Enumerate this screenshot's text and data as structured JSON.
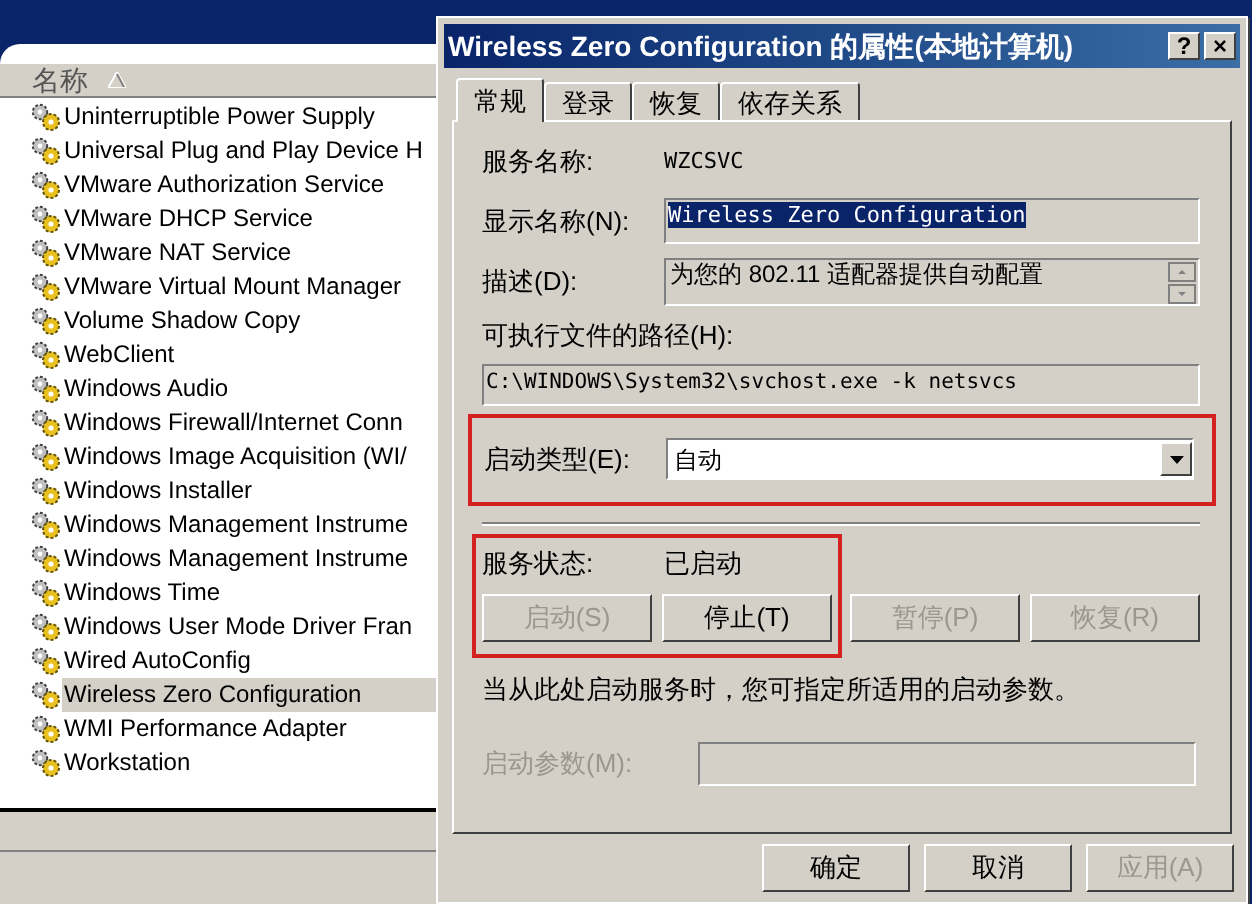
{
  "services_list": {
    "header": "名称",
    "header_sorted": true,
    "rows": [
      {
        "name": "Uninterruptible Power Supply",
        "selected": false
      },
      {
        "name": "Universal Plug and Play Device H",
        "selected": false
      },
      {
        "name": "VMware Authorization Service",
        "selected": false
      },
      {
        "name": "VMware DHCP Service",
        "selected": false
      },
      {
        "name": "VMware NAT Service",
        "selected": false
      },
      {
        "name": "VMware Virtual Mount Manager",
        "selected": false
      },
      {
        "name": "Volume Shadow Copy",
        "selected": false
      },
      {
        "name": "WebClient",
        "selected": false
      },
      {
        "name": "Windows Audio",
        "selected": false
      },
      {
        "name": "Windows Firewall/Internet Conn",
        "selected": false
      },
      {
        "name": "Windows Image Acquisition (WI/",
        "selected": false
      },
      {
        "name": "Windows Installer",
        "selected": false
      },
      {
        "name": "Windows Management Instrume",
        "selected": false
      },
      {
        "name": "Windows Management Instrume",
        "selected": false
      },
      {
        "name": "Windows Time",
        "selected": false
      },
      {
        "name": "Windows User Mode Driver Fran",
        "selected": false
      },
      {
        "name": "Wired AutoConfig",
        "selected": false
      },
      {
        "name": "Wireless Zero Configuration",
        "selected": true
      },
      {
        "name": "WMI Performance Adapter",
        "selected": false
      },
      {
        "name": "Workstation",
        "selected": false
      }
    ]
  },
  "dialog": {
    "title": "Wireless Zero Configuration 的属性(本地计算机)",
    "title_buttons": [
      "?",
      "×"
    ],
    "tabs": [
      {
        "label": "常规",
        "selected": true
      },
      {
        "label": "登录",
        "selected": false
      },
      {
        "label": "恢复",
        "selected": false
      },
      {
        "label": "依存关系",
        "selected": false
      }
    ],
    "service_name": {
      "label": "服务名称:",
      "value": "WZCSVC"
    },
    "display_name": {
      "label": "显示名称(N):",
      "value": "Wireless Zero Configuration",
      "text_selected": true
    },
    "description": {
      "label": "描述(D):",
      "value": "为您的 802.11 适配器提供自动配置"
    },
    "executable_path": {
      "label": "可执行文件的路径(H):",
      "value": "C:\\WINDOWS\\System32\\svchost.exe -k netsvcs"
    },
    "startup_type": {
      "label": "启动类型(E):",
      "value": "自动",
      "highlighted": true
    },
    "service_status": {
      "label": "服务状态:",
      "value": "已启动",
      "highlighted": true
    },
    "control_buttons": [
      {
        "label": "启动(S)",
        "disabled": true
      },
      {
        "label": "停止(T)",
        "disabled": false
      },
      {
        "label": "暂停(P)",
        "disabled": true
      },
      {
        "label": "恢复(R)",
        "disabled": true
      }
    ],
    "hint": "当从此处启动服务时，您可指定所适用的启动参数。",
    "start_parameters": {
      "label": "启动参数(M):",
      "disabled": true
    },
    "footer_buttons": [
      {
        "label": "确定",
        "disabled": false
      },
      {
        "label": "取消",
        "disabled": false
      },
      {
        "label": "应用(A)",
        "disabled": true
      }
    ]
  }
}
